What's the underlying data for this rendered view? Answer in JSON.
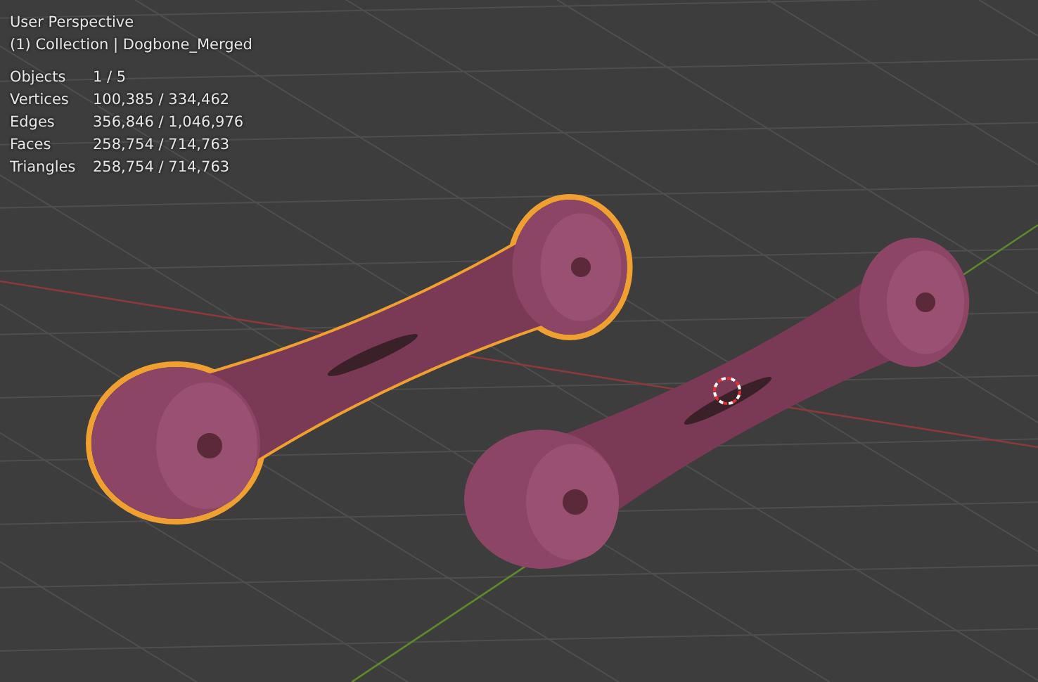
{
  "viewport": {
    "view_name": "User Perspective",
    "collection_line": "(1) Collection | Dogbone_Merged"
  },
  "statistics": [
    {
      "label": "Objects",
      "value": "1 / 5"
    },
    {
      "label": "Vertices",
      "value": "100,385 / 334,462"
    },
    {
      "label": "Edges",
      "value": "356,846 / 1,046,976"
    },
    {
      "label": "Faces",
      "value": "258,754 / 714,763"
    },
    {
      "label": "Triangles",
      "value": "258,754 / 714,763"
    }
  ],
  "scene_objects": [
    {
      "selected": true
    },
    {
      "selected": false
    }
  ]
}
